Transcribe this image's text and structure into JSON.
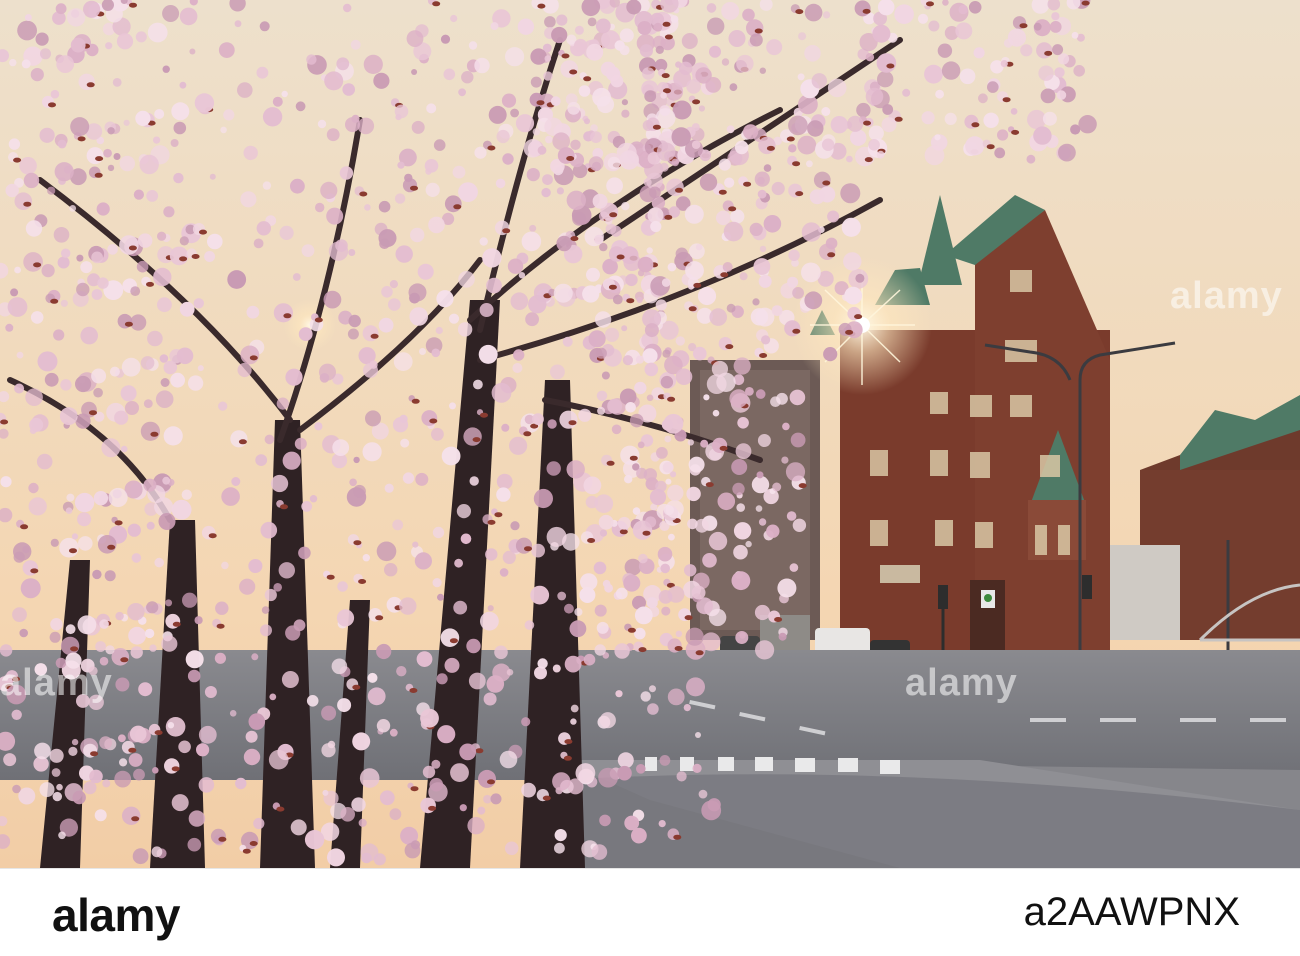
{
  "scene": {
    "description_icons": [
      "cherry-blossom-tree",
      "brick-building",
      "street-lamp",
      "traffic-light",
      "sun-flare"
    ],
    "colors": {
      "sky_top": "#efe2cf",
      "sky_bottom": "#f6d7b0",
      "blossom": "#e8c2d4",
      "blossom_dark": "#c99bb4",
      "branch": "#3a2a2c",
      "brick": "#7a3b2c",
      "roof_green": "#4f7a66",
      "road": "#7d7e84",
      "sidewalk": "#8a8a8f"
    }
  },
  "watermarks": {
    "center": "alamy",
    "left": "alamy",
    "right": "alamy"
  },
  "footer": {
    "logo": "alamy",
    "image_id": "a2AAWPNX"
  }
}
